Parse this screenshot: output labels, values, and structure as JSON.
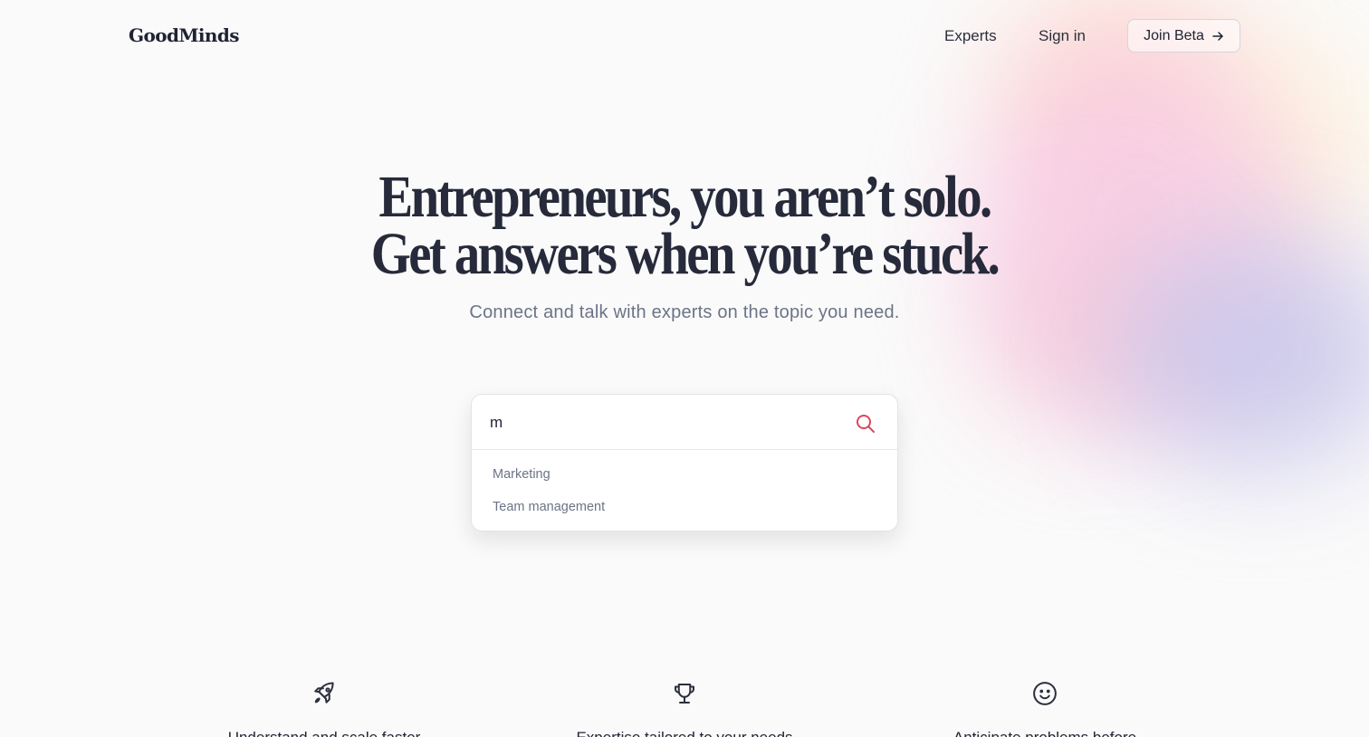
{
  "header": {
    "logo": "GoodMinds",
    "nav": {
      "experts": "Experts",
      "sign_in": "Sign in"
    },
    "join_button": "Join Beta",
    "join_icon": "arrow-right-icon"
  },
  "hero": {
    "title_line1": "Entrepreneurs, you aren’t solo.",
    "title_line2": "Get answers when you’re stuck.",
    "subtitle": "Connect and talk with experts on the topic you need."
  },
  "search": {
    "value": "m",
    "icon": "search-icon",
    "suggestions": [
      "Marketing",
      "Team management"
    ]
  },
  "features": [
    {
      "icon": "rocket-icon",
      "text": "Understand and scale faster"
    },
    {
      "icon": "trophy-icon",
      "text": "Expertise tailored to your needs"
    },
    {
      "icon": "smiley-icon",
      "text": "Anticipate problems before"
    }
  ],
  "colors": {
    "text": "#1f2333",
    "muted": "#6b7487",
    "search_icon": "#d9475b",
    "background": "#fafafa"
  }
}
